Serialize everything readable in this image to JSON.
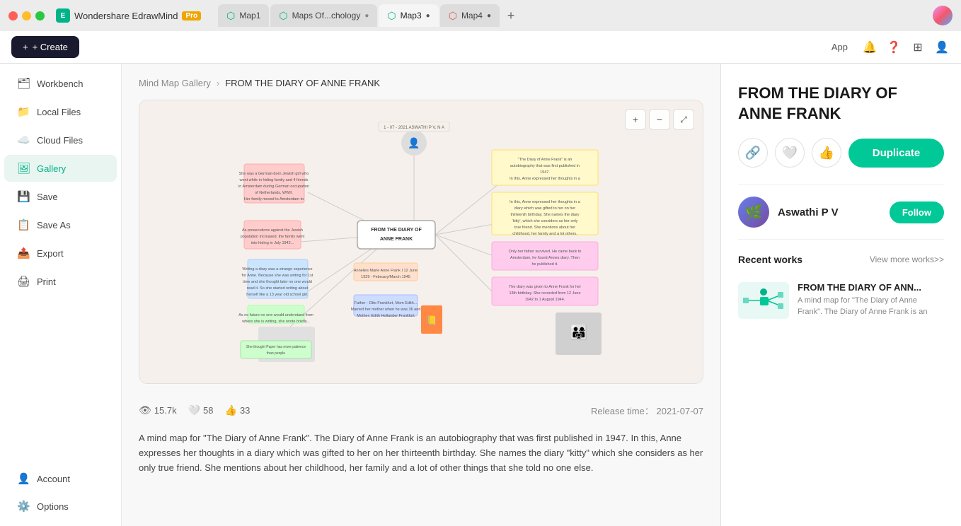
{
  "app": {
    "name": "Wondershare EdrawMind",
    "badge": "Pro"
  },
  "tabs": [
    {
      "id": "map1",
      "label": "Map1",
      "color": "#00b388",
      "active": false,
      "dot_color": "#888"
    },
    {
      "id": "maps-of-chology",
      "label": "Maps Of...chology",
      "color": "#00b388",
      "active": false,
      "dot_color": "#888"
    },
    {
      "id": "map3",
      "label": "Map3",
      "color": "#00b388",
      "active": false,
      "dot_color": "#555"
    },
    {
      "id": "map4",
      "label": "Map4",
      "color": "#00b388",
      "active": false,
      "dot_color": "#555"
    }
  ],
  "toolbar": {
    "create_label": "+ Create",
    "app_label": "App"
  },
  "sidebar": {
    "items": [
      {
        "id": "workbench",
        "label": "Workbench",
        "icon": "🗂",
        "active": false
      },
      {
        "id": "local-files",
        "label": "Local Files",
        "icon": "📁",
        "active": false
      },
      {
        "id": "cloud-files",
        "label": "Cloud Files",
        "icon": "☁️",
        "active": false
      },
      {
        "id": "gallery",
        "label": "Gallery",
        "icon": "🖼",
        "active": true
      },
      {
        "id": "save",
        "label": "Save",
        "icon": "💾",
        "active": false
      },
      {
        "id": "save-as",
        "label": "Save As",
        "icon": "📋",
        "active": false
      },
      {
        "id": "export",
        "label": "Export",
        "icon": "📤",
        "active": false
      },
      {
        "id": "print",
        "label": "Print",
        "icon": "🖨",
        "active": false
      }
    ],
    "bottom_items": [
      {
        "id": "account",
        "label": "Account",
        "icon": "👤",
        "active": false
      },
      {
        "id": "options",
        "label": "Options",
        "icon": "⚙️",
        "active": false
      }
    ]
  },
  "breadcrumb": {
    "parent": "Mind Map Gallery",
    "separator": "›",
    "current": "FROM THE DIARY OF ANNE FRANK"
  },
  "map_preview": {
    "zoom_in": "+",
    "zoom_out": "−",
    "fullscreen": "⤢"
  },
  "stats": {
    "views": "15.7k",
    "views_icon": "👁",
    "likes": "58",
    "likes_icon": "🤍",
    "thumbs_up": "33",
    "thumbs_icon": "👍",
    "release_label": "Release time：",
    "release_date": "2021-07-07"
  },
  "description": "A mind map for \"The Diary of Anne Frank\". The Diary of Anne Frank is an autobiography that was first published in 1947. In this, Anne expresses her thoughts in a diary which was gifted to her on her thirteenth birthday. She names the diary \"kitty\" which she considers as her only true friend. She mentions about her childhood, her family and a lot of other things that she told no one else.",
  "right_panel": {
    "title": "FROM THE DIARY OF ANNE FRANK",
    "duplicate_label": "Duplicate",
    "author": {
      "name": "Aswathi P V",
      "avatar_emoji": "🌿"
    },
    "follow_label": "Follow",
    "recent_works_title": "Recent works",
    "view_more_label": "View more works>>",
    "recent_works": [
      {
        "title": "FROM THE DIARY OF ANN...",
        "description": "A mind map for \"The Diary of Anne Frank\". The Diary of Anne Frank is an"
      }
    ]
  }
}
